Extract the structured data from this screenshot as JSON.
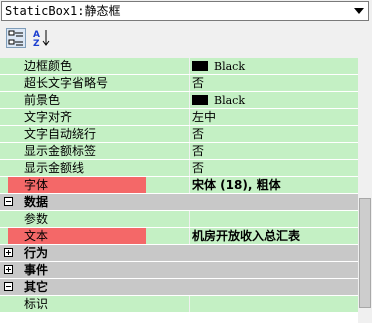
{
  "object_selector": {
    "value": "StaticBox1:静态框"
  },
  "toolbar": {
    "categorized_label": "",
    "alphabetical_label": ""
  },
  "colors": {
    "property_bg": "#c4f0c4",
    "category_bg": "#c8c8c8",
    "highlight_bg": "#f46868"
  },
  "rows": [
    {
      "kind": "prop",
      "name": "边框颜色",
      "value": "Black",
      "swatch": true,
      "value_bold": false,
      "highlight": false
    },
    {
      "kind": "prop",
      "name": "超长文字省略号",
      "value": "否",
      "swatch": false,
      "value_bold": false,
      "highlight": false
    },
    {
      "kind": "prop",
      "name": "前景色",
      "value": "Black",
      "swatch": true,
      "value_bold": false,
      "highlight": false
    },
    {
      "kind": "prop",
      "name": "文字对齐",
      "value": "左中",
      "swatch": false,
      "value_bold": false,
      "highlight": false
    },
    {
      "kind": "prop",
      "name": "文字自动绕行",
      "value": "否",
      "swatch": false,
      "value_bold": false,
      "highlight": false
    },
    {
      "kind": "prop",
      "name": "显示金额标签",
      "value": "否",
      "swatch": false,
      "value_bold": false,
      "highlight": false
    },
    {
      "kind": "prop",
      "name": "显示金额线",
      "value": "否",
      "swatch": false,
      "value_bold": false,
      "highlight": false
    },
    {
      "kind": "prop",
      "name": "字体",
      "value": "宋体 (18), 粗体",
      "swatch": false,
      "value_bold": true,
      "highlight": true
    },
    {
      "kind": "cat",
      "name": "数据",
      "expanded": true
    },
    {
      "kind": "prop",
      "name": "参数",
      "value": "",
      "swatch": false,
      "value_bold": false,
      "highlight": false
    },
    {
      "kind": "prop",
      "name": "文本",
      "value": "机房开放收入总汇表",
      "swatch": false,
      "value_bold": true,
      "highlight": true
    },
    {
      "kind": "cat",
      "name": "行为",
      "expanded": false
    },
    {
      "kind": "cat",
      "name": "事件",
      "expanded": false
    },
    {
      "kind": "cat",
      "name": "其它",
      "expanded": true
    },
    {
      "kind": "prop",
      "name": "标识",
      "value": "",
      "swatch": false,
      "value_bold": false,
      "highlight": false
    }
  ]
}
